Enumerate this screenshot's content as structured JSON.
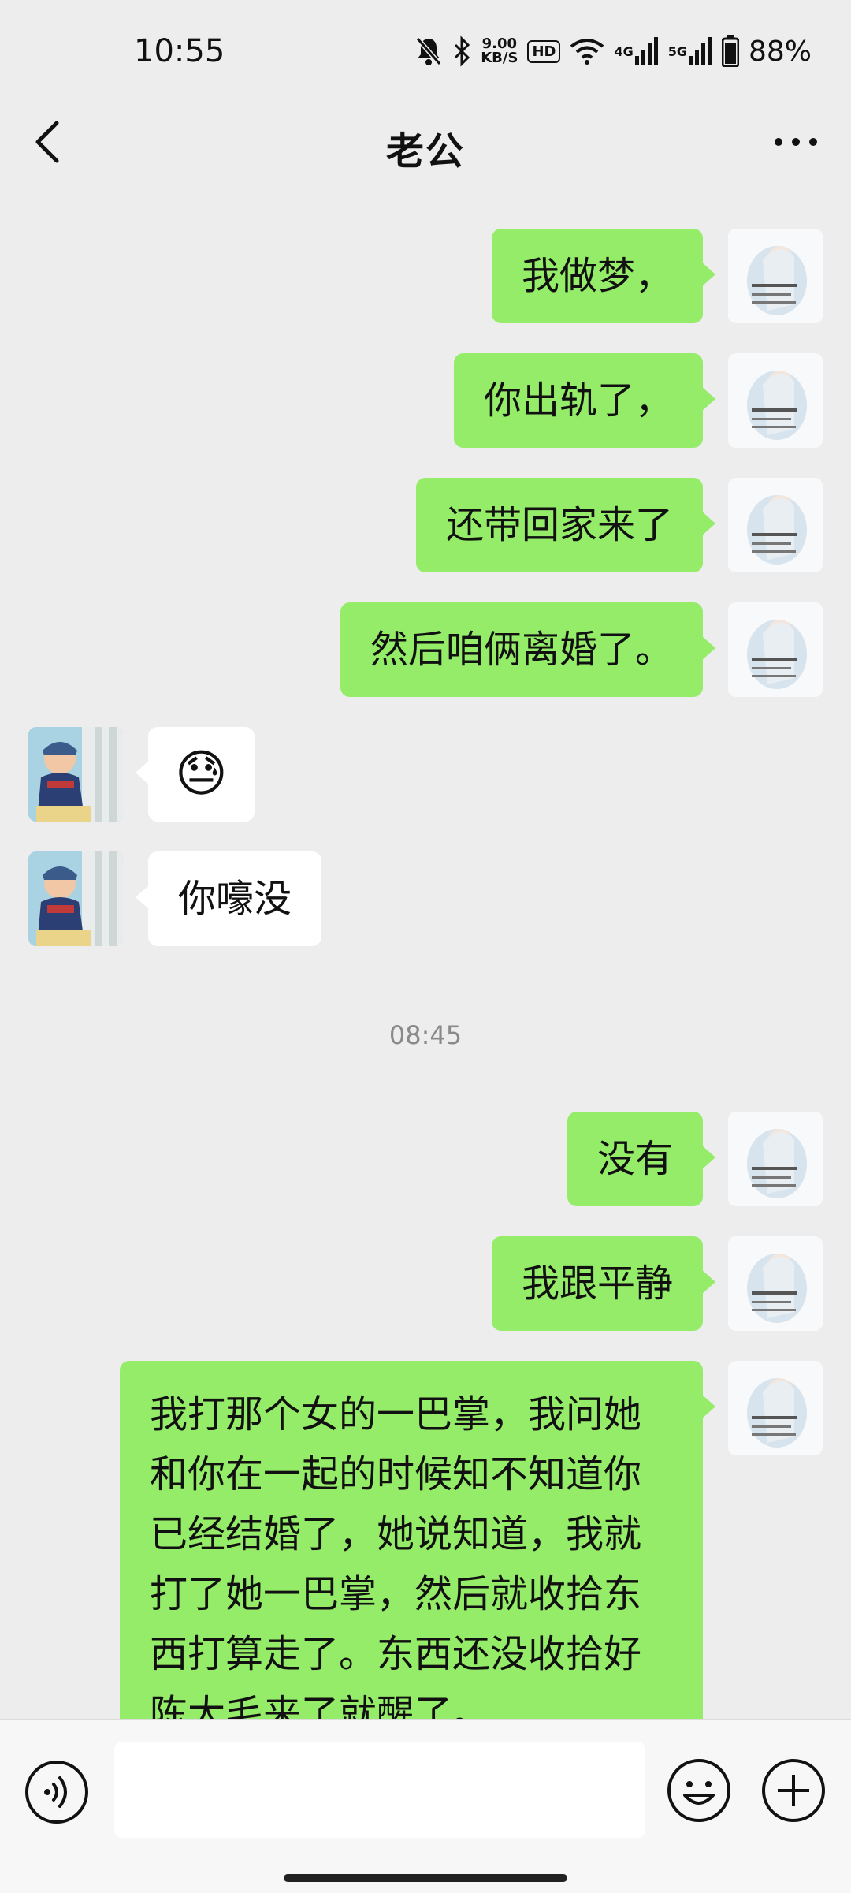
{
  "status_bar": {
    "time": "10:55",
    "speed_value": "9.00",
    "speed_unit": "KB/S",
    "hd_label": "HD",
    "net1": "4G",
    "net2": "5G",
    "battery": "88%"
  },
  "header": {
    "title": "老公"
  },
  "messages": [
    {
      "side": "me",
      "text": "我做梦，"
    },
    {
      "side": "me",
      "text": "你出轨了，"
    },
    {
      "side": "me",
      "text": "还带回家来了"
    },
    {
      "side": "me",
      "text": "然后咱俩离婚了。"
    },
    {
      "side": "other",
      "text": "😓"
    },
    {
      "side": "other",
      "text": "你嚎没"
    },
    {
      "side": "me",
      "text": "没有"
    },
    {
      "side": "me",
      "text": "我跟平静"
    },
    {
      "side": "me",
      "text": "我打那个女的一巴掌，我问她和你在一起的时候知不知道你已经结婚了，她说知道，我就打了她一巴掌，然后就收拾东西打算走了。东西还没收拾好陈大毛来了就醒了。"
    }
  ],
  "timestamp": "08:45",
  "colors": {
    "background": "#ededed",
    "my_bubble": "#95ec69",
    "other_bubble": "#ffffff"
  },
  "icons": {
    "back": "chevron-left-icon",
    "more": "more-dots-icon",
    "voice": "voice-icon",
    "emoji": "emoji-icon",
    "plus": "plus-icon"
  }
}
